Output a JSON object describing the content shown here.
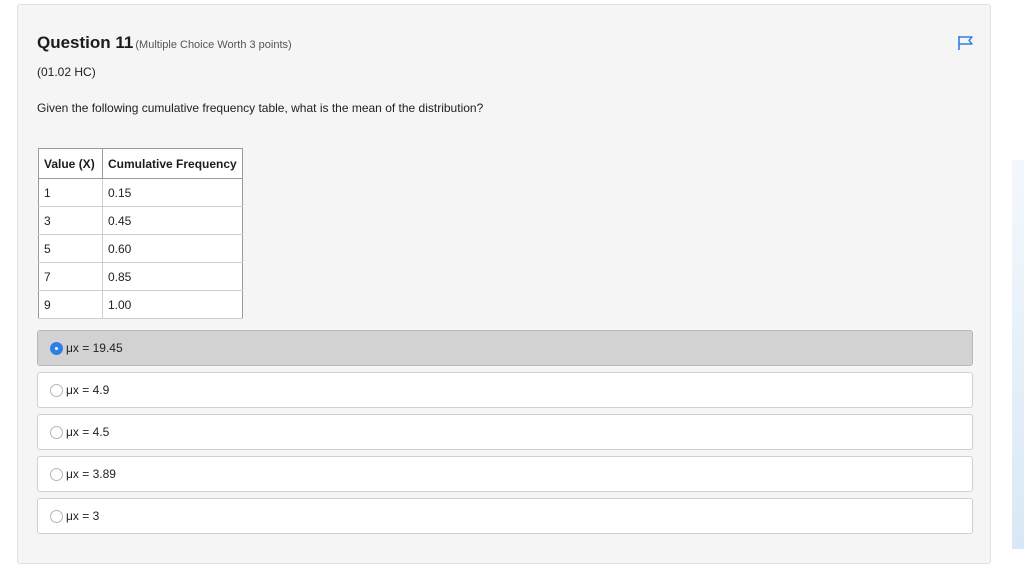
{
  "question": {
    "title": "Question 11",
    "worth": "(Multiple Choice Worth 3 points)",
    "code": "(01.02 HC)",
    "text": "Given the following cumulative frequency table, what is the mean of the distribution?",
    "flag_icon": "flag-icon"
  },
  "table": {
    "headers": [
      "Value (X)",
      "Cumulative Frequency"
    ],
    "rows": [
      [
        "1",
        "0.15"
      ],
      [
        "3",
        "0.45"
      ],
      [
        "5",
        "0.60"
      ],
      [
        "7",
        "0.85"
      ],
      [
        "9",
        "1.00"
      ]
    ]
  },
  "options": [
    {
      "label": "μx = 19.45",
      "selected": true
    },
    {
      "label": "μx = 4.9",
      "selected": false
    },
    {
      "label": "μx = 4.5",
      "selected": false
    },
    {
      "label": "μx = 3.89",
      "selected": false
    },
    {
      "label": "μx = 3",
      "selected": false
    }
  ],
  "colors": {
    "accent": "#2f7ee8",
    "selected_bg": "#d2d2d2",
    "card_bg": "#f5f5f5"
  }
}
